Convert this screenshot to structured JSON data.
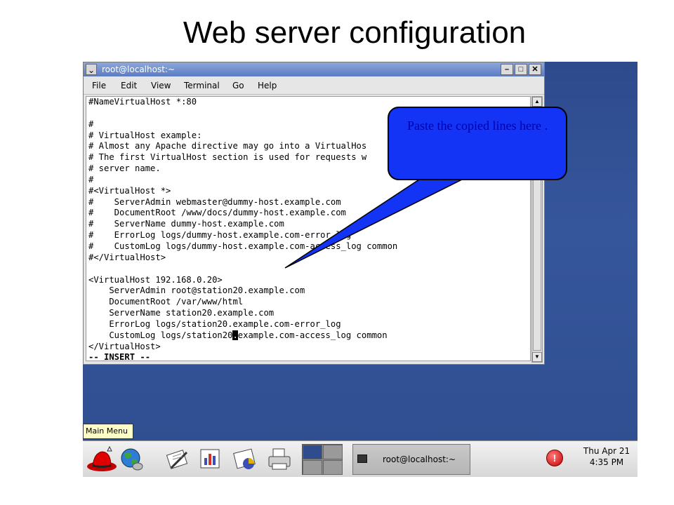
{
  "slide": {
    "title": "Web server configuration"
  },
  "window": {
    "title": "root@localhost:~",
    "menu": [
      "File",
      "Edit",
      "View",
      "Terminal",
      "Go",
      "Help"
    ]
  },
  "terminal": {
    "lines": [
      "#NameVirtualHost *:80",
      "",
      "#",
      "# VirtualHost example:",
      "# Almost any Apache directive may go into a VirtualHos",
      "# The first VirtualHost section is used for requests w",
      "# server name.",
      "#",
      "#<VirtualHost *>",
      "#    ServerAdmin webmaster@dummy-host.example.com",
      "#    DocumentRoot /www/docs/dummy-host.example.com",
      "#    ServerName dummy-host.example.com",
      "#    ErrorLog logs/dummy-host.example.com-error_log",
      "#    CustomLog logs/dummy-host.example.com-access_log common",
      "#</VirtualHost>",
      "",
      "<VirtualHost 192.168.0.20>",
      "    ServerAdmin root@station20.example.com",
      "    DocumentRoot /var/www/html",
      "    ServerName station20.example.com",
      "    ErrorLog logs/station20.example.com-error_log"
    ],
    "cursor_line": {
      "before": "    CustomLog logs/station20",
      "cursor": ".",
      "after": "example.com-access_log common"
    },
    "closing_line": "</VirtualHost>",
    "status_line": "-- INSERT --"
  },
  "callout": {
    "text": "Paste the copied lines here ."
  },
  "taskbar": {
    "main_menu_tooltip": "Main Menu",
    "task_button": "root@localhost:~",
    "clock_day": "Thu Apr 21",
    "clock_time": "4:35 PM",
    "alert_symbol": "!"
  },
  "colors": {
    "desktop": "#2f4e90",
    "callout_fill": "#1434f5",
    "callout_text": "#0000aa"
  }
}
